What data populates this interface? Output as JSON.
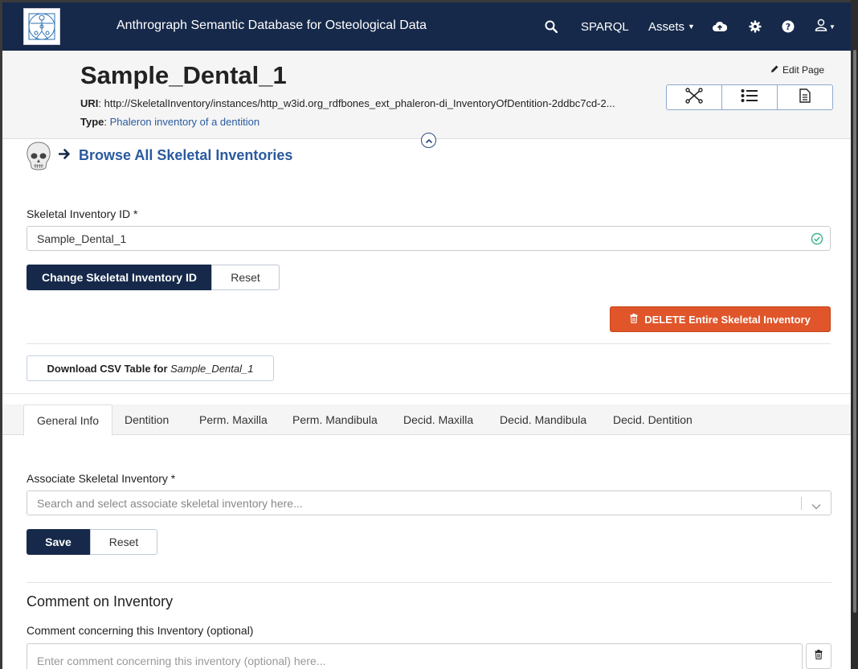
{
  "navbar": {
    "app_title": "Anthrograph Semantic Database for Osteological Data",
    "sparql_label": "SPARQL",
    "assets_label": "Assets",
    "icons": [
      "search-icon",
      "cloud-upload-icon",
      "gear-icon",
      "help-icon",
      "user-icon"
    ]
  },
  "header": {
    "title": "Sample_Dental_1",
    "uri_label": "URI",
    "uri_value": "http://SkeletalInventory/instances/http_w3id.org_rdfbones_ext_phaleron-di_InventoryOfDentition-2ddbc7cd-2...",
    "type_label": "Type",
    "type_value": "Phaleron inventory of a dentition",
    "edit_page_label": "Edit Page"
  },
  "browse": {
    "label": "Browse All Skeletal Inventories"
  },
  "id_form": {
    "label": "Skeletal Inventory ID *",
    "value": "Sample_Dental_1",
    "change_label": "Change Skeletal Inventory ID",
    "reset_label": "Reset"
  },
  "delete_label": "DELETE Entire Skeletal Inventory",
  "csv": {
    "prefix": "Download CSV Table for ",
    "name": "Sample_Dental_1"
  },
  "tabs": [
    "General Info",
    "Dentition",
    "Perm. Maxilla",
    "Perm. Mandibula",
    "Decid. Maxilla",
    "Decid. Mandibula",
    "Decid. Dentition"
  ],
  "associate": {
    "label": "Associate Skeletal Inventory *",
    "placeholder": "Search and select associate skeletal inventory here...",
    "save_label": "Save",
    "reset_label": "Reset"
  },
  "comment": {
    "section_title": "Comment on Inventory",
    "label": "Comment concerning this Inventory (optional)",
    "placeholder": "Enter comment concerning this inventory (optional) here..."
  },
  "colors": {
    "navbar": "#16294a",
    "link": "#2a5a9e",
    "danger": "#e0552a",
    "success": "#3cb38a"
  }
}
